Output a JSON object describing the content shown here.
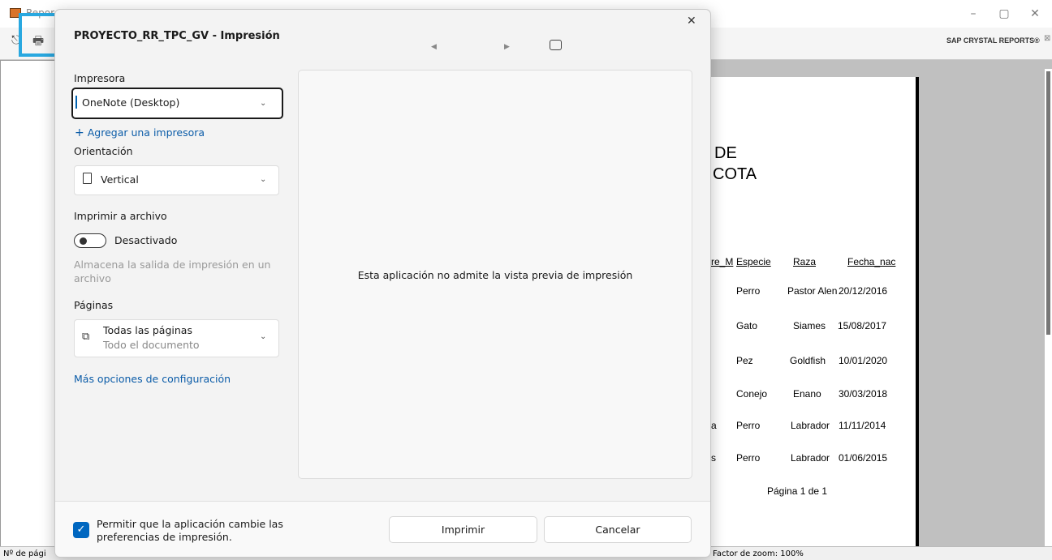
{
  "background_app": {
    "title": "Repor",
    "brand": "SAP CRYSTAL REPORTS®",
    "status_left": "Nº de pági",
    "status_zoom": "Factor de zoom: 100%",
    "report": {
      "heading_lines": [
        "DE",
        "COTA"
      ],
      "columns": [
        "re_M",
        "Especie",
        "Raza",
        "Fecha_nac"
      ],
      "rows": [
        {
          "left": "",
          "especie": "Perro",
          "raza": "Pastor Alen",
          "fecha": "20/12/2016"
        },
        {
          "left": "",
          "especie": "Gato",
          "raza": "Siames",
          "fecha": "15/08/2017"
        },
        {
          "left": "",
          "especie": "Pez",
          "raza": "Goldfish",
          "fecha": "10/01/2020"
        },
        {
          "left": "",
          "especie": "Conejo",
          "raza": "Enano",
          "fecha": "30/03/2018"
        },
        {
          "left": "a",
          "especie": "Perro",
          "raza": "Labrador",
          "fecha": "11/11/2014"
        },
        {
          "left": "s",
          "especie": "Perro",
          "raza": "Labrador",
          "fecha": "01/06/2015"
        }
      ],
      "page_footer": "Página 1 de 1"
    }
  },
  "dialog": {
    "title": "PROYECTO_RR_TPC_GV - Impresión",
    "printer_label": "Impresora",
    "printer_value": "OneNote (Desktop)",
    "add_printer": "Agregar una impresora",
    "orientation_label": "Orientación",
    "orientation_value": "Vertical",
    "print_to_file_label": "Imprimir a archivo",
    "print_to_file_state": "Desactivado",
    "print_to_file_desc": "Almacena la salida de impresión en un archivo",
    "pages_label": "Páginas",
    "pages_value": "Todas las páginas",
    "pages_sub": "Todo el documento",
    "more_options": "Más opciones de configuración",
    "preview_message": "Esta aplicación no admite la vista previa de impresión",
    "allow_prefs": "Permitir que la aplicación cambie las preferencias de impresión.",
    "print_button": "Imprimir",
    "cancel_button": "Cancelar"
  },
  "colors": {
    "accent": "#0067c0",
    "link": "#0b5ca8",
    "highlight": "#29a8e0"
  }
}
